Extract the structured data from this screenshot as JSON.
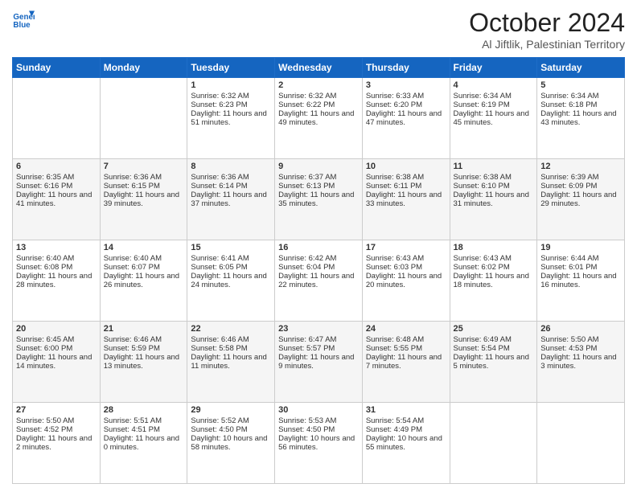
{
  "header": {
    "logo_line1": "General",
    "logo_line2": "Blue",
    "title": "October 2024",
    "subtitle": "Al Jiftlik, Palestinian Territory"
  },
  "days_of_week": [
    "Sunday",
    "Monday",
    "Tuesday",
    "Wednesday",
    "Thursday",
    "Friday",
    "Saturday"
  ],
  "weeks": [
    [
      {
        "day": "",
        "sunrise": "",
        "sunset": "",
        "daylight": ""
      },
      {
        "day": "",
        "sunrise": "",
        "sunset": "",
        "daylight": ""
      },
      {
        "day": "1",
        "sunrise": "Sunrise: 6:32 AM",
        "sunset": "Sunset: 6:23 PM",
        "daylight": "Daylight: 11 hours and 51 minutes."
      },
      {
        "day": "2",
        "sunrise": "Sunrise: 6:32 AM",
        "sunset": "Sunset: 6:22 PM",
        "daylight": "Daylight: 11 hours and 49 minutes."
      },
      {
        "day": "3",
        "sunrise": "Sunrise: 6:33 AM",
        "sunset": "Sunset: 6:20 PM",
        "daylight": "Daylight: 11 hours and 47 minutes."
      },
      {
        "day": "4",
        "sunrise": "Sunrise: 6:34 AM",
        "sunset": "Sunset: 6:19 PM",
        "daylight": "Daylight: 11 hours and 45 minutes."
      },
      {
        "day": "5",
        "sunrise": "Sunrise: 6:34 AM",
        "sunset": "Sunset: 6:18 PM",
        "daylight": "Daylight: 11 hours and 43 minutes."
      }
    ],
    [
      {
        "day": "6",
        "sunrise": "Sunrise: 6:35 AM",
        "sunset": "Sunset: 6:16 PM",
        "daylight": "Daylight: 11 hours and 41 minutes."
      },
      {
        "day": "7",
        "sunrise": "Sunrise: 6:36 AM",
        "sunset": "Sunset: 6:15 PM",
        "daylight": "Daylight: 11 hours and 39 minutes."
      },
      {
        "day": "8",
        "sunrise": "Sunrise: 6:36 AM",
        "sunset": "Sunset: 6:14 PM",
        "daylight": "Daylight: 11 hours and 37 minutes."
      },
      {
        "day": "9",
        "sunrise": "Sunrise: 6:37 AM",
        "sunset": "Sunset: 6:13 PM",
        "daylight": "Daylight: 11 hours and 35 minutes."
      },
      {
        "day": "10",
        "sunrise": "Sunrise: 6:38 AM",
        "sunset": "Sunset: 6:11 PM",
        "daylight": "Daylight: 11 hours and 33 minutes."
      },
      {
        "day": "11",
        "sunrise": "Sunrise: 6:38 AM",
        "sunset": "Sunset: 6:10 PM",
        "daylight": "Daylight: 11 hours and 31 minutes."
      },
      {
        "day": "12",
        "sunrise": "Sunrise: 6:39 AM",
        "sunset": "Sunset: 6:09 PM",
        "daylight": "Daylight: 11 hours and 29 minutes."
      }
    ],
    [
      {
        "day": "13",
        "sunrise": "Sunrise: 6:40 AM",
        "sunset": "Sunset: 6:08 PM",
        "daylight": "Daylight: 11 hours and 28 minutes."
      },
      {
        "day": "14",
        "sunrise": "Sunrise: 6:40 AM",
        "sunset": "Sunset: 6:07 PM",
        "daylight": "Daylight: 11 hours and 26 minutes."
      },
      {
        "day": "15",
        "sunrise": "Sunrise: 6:41 AM",
        "sunset": "Sunset: 6:05 PM",
        "daylight": "Daylight: 11 hours and 24 minutes."
      },
      {
        "day": "16",
        "sunrise": "Sunrise: 6:42 AM",
        "sunset": "Sunset: 6:04 PM",
        "daylight": "Daylight: 11 hours and 22 minutes."
      },
      {
        "day": "17",
        "sunrise": "Sunrise: 6:43 AM",
        "sunset": "Sunset: 6:03 PM",
        "daylight": "Daylight: 11 hours and 20 minutes."
      },
      {
        "day": "18",
        "sunrise": "Sunrise: 6:43 AM",
        "sunset": "Sunset: 6:02 PM",
        "daylight": "Daylight: 11 hours and 18 minutes."
      },
      {
        "day": "19",
        "sunrise": "Sunrise: 6:44 AM",
        "sunset": "Sunset: 6:01 PM",
        "daylight": "Daylight: 11 hours and 16 minutes."
      }
    ],
    [
      {
        "day": "20",
        "sunrise": "Sunrise: 6:45 AM",
        "sunset": "Sunset: 6:00 PM",
        "daylight": "Daylight: 11 hours and 14 minutes."
      },
      {
        "day": "21",
        "sunrise": "Sunrise: 6:46 AM",
        "sunset": "Sunset: 5:59 PM",
        "daylight": "Daylight: 11 hours and 13 minutes."
      },
      {
        "day": "22",
        "sunrise": "Sunrise: 6:46 AM",
        "sunset": "Sunset: 5:58 PM",
        "daylight": "Daylight: 11 hours and 11 minutes."
      },
      {
        "day": "23",
        "sunrise": "Sunrise: 6:47 AM",
        "sunset": "Sunset: 5:57 PM",
        "daylight": "Daylight: 11 hours and 9 minutes."
      },
      {
        "day": "24",
        "sunrise": "Sunrise: 6:48 AM",
        "sunset": "Sunset: 5:55 PM",
        "daylight": "Daylight: 11 hours and 7 minutes."
      },
      {
        "day": "25",
        "sunrise": "Sunrise: 6:49 AM",
        "sunset": "Sunset: 5:54 PM",
        "daylight": "Daylight: 11 hours and 5 minutes."
      },
      {
        "day": "26",
        "sunrise": "Sunrise: 5:50 AM",
        "sunset": "Sunset: 4:53 PM",
        "daylight": "Daylight: 11 hours and 3 minutes."
      }
    ],
    [
      {
        "day": "27",
        "sunrise": "Sunrise: 5:50 AM",
        "sunset": "Sunset: 4:52 PM",
        "daylight": "Daylight: 11 hours and 2 minutes."
      },
      {
        "day": "28",
        "sunrise": "Sunrise: 5:51 AM",
        "sunset": "Sunset: 4:51 PM",
        "daylight": "Daylight: 11 hours and 0 minutes."
      },
      {
        "day": "29",
        "sunrise": "Sunrise: 5:52 AM",
        "sunset": "Sunset: 4:50 PM",
        "daylight": "Daylight: 10 hours and 58 minutes."
      },
      {
        "day": "30",
        "sunrise": "Sunrise: 5:53 AM",
        "sunset": "Sunset: 4:50 PM",
        "daylight": "Daylight: 10 hours and 56 minutes."
      },
      {
        "day": "31",
        "sunrise": "Sunrise: 5:54 AM",
        "sunset": "Sunset: 4:49 PM",
        "daylight": "Daylight: 10 hours and 55 minutes."
      },
      {
        "day": "",
        "sunrise": "",
        "sunset": "",
        "daylight": ""
      },
      {
        "day": "",
        "sunrise": "",
        "sunset": "",
        "daylight": ""
      }
    ]
  ]
}
